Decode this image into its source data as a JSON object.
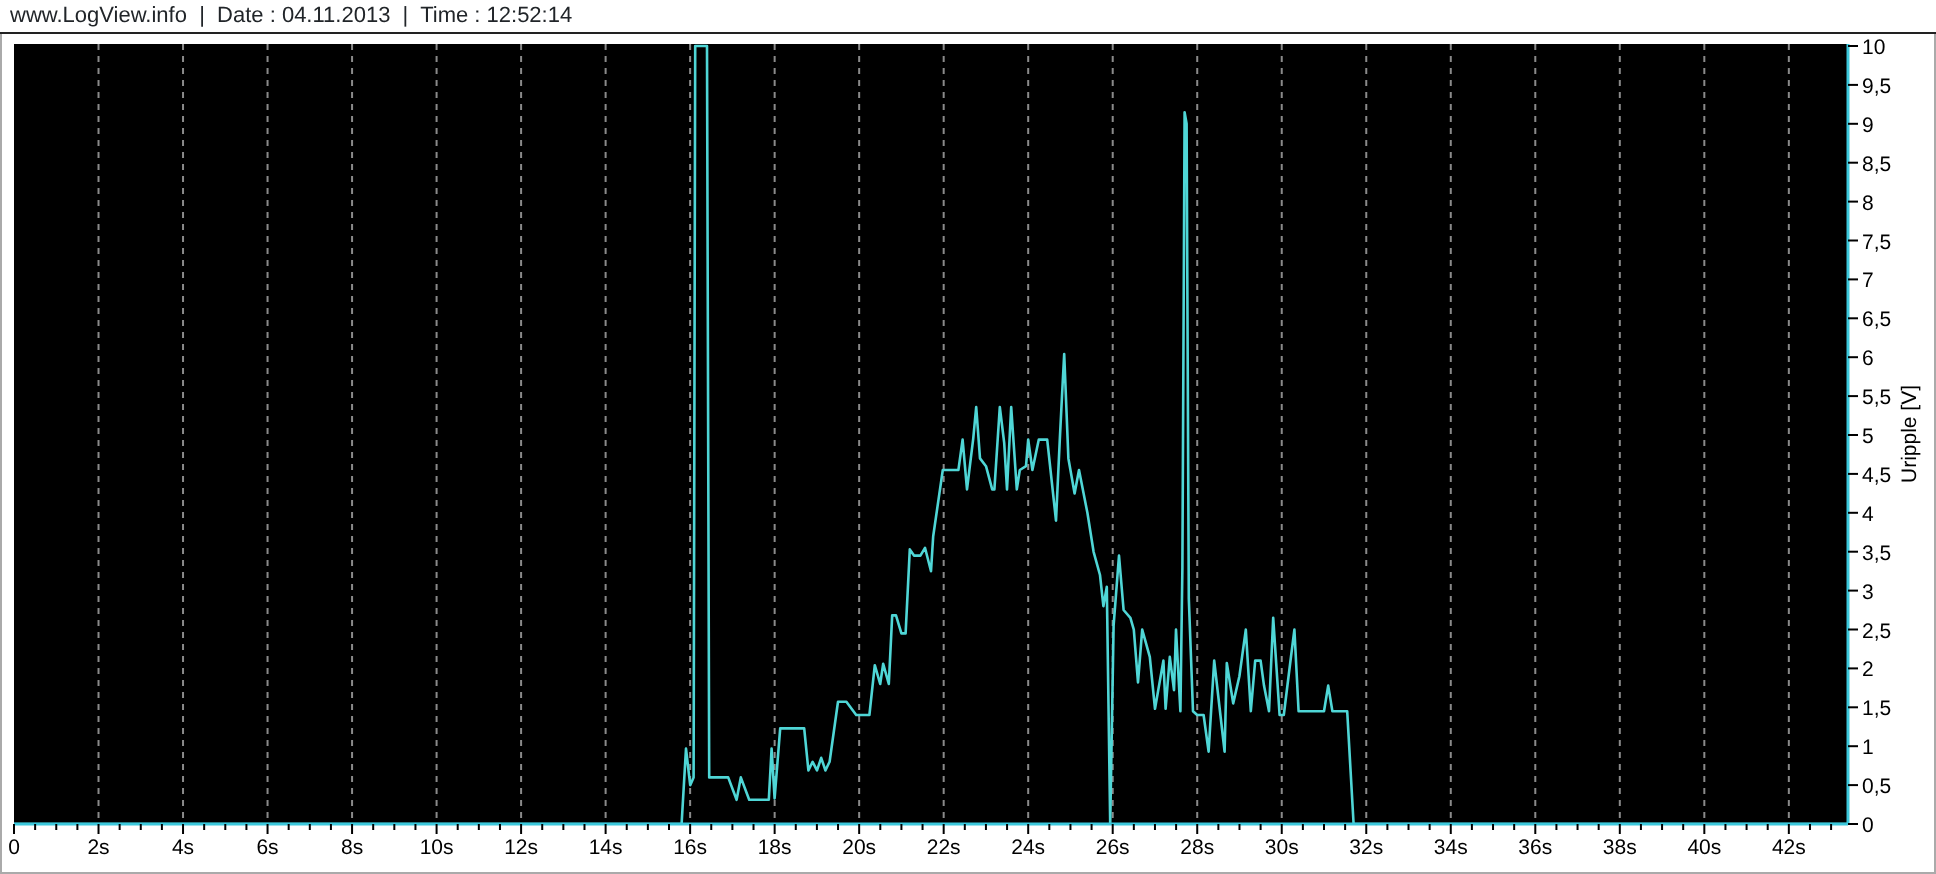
{
  "header": {
    "text": "www.LogView.info  |  Date : 04.11.2013  |  Time : 12:52:14"
  },
  "chart": {
    "chart_data": {
      "type": "line",
      "ylabel": "Uripple [V]",
      "xlim": [
        0,
        43.4
      ],
      "ylim": [
        0,
        10
      ],
      "xticks": [
        {
          "value": 0,
          "label": "0"
        },
        {
          "value": 2,
          "label": "2s"
        },
        {
          "value": 4,
          "label": "4s"
        },
        {
          "value": 6,
          "label": "6s"
        },
        {
          "value": 8,
          "label": "8s"
        },
        {
          "value": 10,
          "label": "10s"
        },
        {
          "value": 12,
          "label": "12s"
        },
        {
          "value": 14,
          "label": "14s"
        },
        {
          "value": 16,
          "label": "16s"
        },
        {
          "value": 18,
          "label": "18s"
        },
        {
          "value": 20,
          "label": "20s"
        },
        {
          "value": 22,
          "label": "22s"
        },
        {
          "value": 24,
          "label": "24s"
        },
        {
          "value": 26,
          "label": "26s"
        },
        {
          "value": 28,
          "label": "28s"
        },
        {
          "value": 30,
          "label": "30s"
        },
        {
          "value": 32,
          "label": "32s"
        },
        {
          "value": 34,
          "label": "34s"
        },
        {
          "value": 36,
          "label": "36s"
        },
        {
          "value": 38,
          "label": "38s"
        },
        {
          "value": 40,
          "label": "40s"
        },
        {
          "value": 42,
          "label": "42s"
        }
      ],
      "yticks": [
        {
          "value": 0,
          "label": "0"
        },
        {
          "value": 0.5,
          "label": "0,5"
        },
        {
          "value": 1,
          "label": "1"
        },
        {
          "value": 1.5,
          "label": "1,5"
        },
        {
          "value": 2,
          "label": "2"
        },
        {
          "value": 2.5,
          "label": "2,5"
        },
        {
          "value": 3,
          "label": "3"
        },
        {
          "value": 3.5,
          "label": "3,5"
        },
        {
          "value": 4,
          "label": "4"
        },
        {
          "value": 4.5,
          "label": "4,5"
        },
        {
          "value": 5,
          "label": "5"
        },
        {
          "value": 5.5,
          "label": "5,5"
        },
        {
          "value": 6,
          "label": "6"
        },
        {
          "value": 6.5,
          "label": "6,5"
        },
        {
          "value": 7,
          "label": "7"
        },
        {
          "value": 7.5,
          "label": "7,5"
        },
        {
          "value": 8,
          "label": "8"
        },
        {
          "value": 8.5,
          "label": "8,5"
        },
        {
          "value": 9,
          "label": "9"
        },
        {
          "value": 9.5,
          "label": "9,5"
        },
        {
          "value": 10,
          "label": "10"
        }
      ],
      "x": [
        0,
        15.8,
        15.9,
        16.0,
        16.08,
        16.12,
        16.4,
        16.45,
        16.9,
        17.1,
        17.2,
        17.4,
        17.86,
        17.93,
        18.0,
        18.13,
        18.7,
        18.8,
        18.9,
        19.0,
        19.1,
        19.2,
        19.3,
        19.5,
        19.7,
        19.93,
        20.24,
        20.37,
        20.5,
        20.57,
        20.7,
        20.78,
        20.87,
        21.0,
        21.1,
        21.2,
        21.3,
        21.45,
        21.56,
        21.7,
        21.75,
        21.98,
        22.35,
        22.45,
        22.55,
        22.7,
        22.77,
        22.86,
        23.0,
        23.15,
        23.2,
        23.33,
        23.43,
        23.5,
        23.6,
        23.73,
        23.8,
        23.95,
        24.0,
        24.1,
        24.25,
        24.45,
        24.66,
        24.75,
        24.8,
        24.85,
        24.95,
        25.1,
        25.2,
        25.4,
        25.55,
        25.7,
        25.78,
        25.86,
        25.94,
        26.02,
        26.15,
        26.26,
        26.42,
        26.5,
        26.6,
        26.7,
        26.88,
        27.0,
        27.2,
        27.25,
        27.35,
        27.45,
        27.5,
        27.6,
        27.65,
        27.7,
        27.75,
        27.8,
        27.9,
        28.0,
        28.15,
        28.27,
        28.4,
        28.55,
        28.65,
        28.7,
        28.85,
        29.0,
        29.15,
        29.27,
        29.37,
        29.5,
        29.58,
        29.7,
        29.8,
        29.95,
        30.05,
        30.2,
        30.3,
        30.4,
        31.0,
        31.1,
        31.2,
        31.55,
        31.7,
        43.4
      ],
      "grid": true,
      "series": [
        {
          "color": "#4fd6d6",
          "values": [
            0,
            0,
            0.97,
            0.5,
            0.6,
            10,
            10,
            0.6,
            0.6,
            0.31,
            0.6,
            0.31,
            0.31,
            0.97,
            0.33,
            1.23,
            1.23,
            0.69,
            0.8,
            0.69,
            0.85,
            0.69,
            0.8,
            1.57,
            1.57,
            1.4,
            1.4,
            2.04,
            1.8,
            2.06,
            1.8,
            2.68,
            2.68,
            2.45,
            2.45,
            3.53,
            3.45,
            3.45,
            3.55,
            3.25,
            3.7,
            4.55,
            4.55,
            4.94,
            4.3,
            4.95,
            5.36,
            4.7,
            4.6,
            4.3,
            4.3,
            5.36,
            4.9,
            4.3,
            5.36,
            4.3,
            4.55,
            4.6,
            4.94,
            4.55,
            4.94,
            4.94,
            3.9,
            4.94,
            5.5,
            6.04,
            4.7,
            4.25,
            4.55,
            4.0,
            3.5,
            3.2,
            2.8,
            3.05,
            0,
            2.55,
            3.45,
            2.75,
            2.65,
            2.5,
            1.82,
            2.5,
            2.15,
            1.48,
            2.1,
            1.48,
            2.15,
            1.72,
            2.5,
            1.45,
            3.3,
            9.15,
            9.0,
            2.9,
            1.45,
            1.4,
            1.4,
            0.93,
            2.1,
            1.4,
            0.93,
            2.07,
            1.55,
            1.9,
            2.5,
            1.45,
            2.1,
            2.1,
            1.78,
            1.45,
            2.65,
            1.4,
            1.4,
            2.07,
            2.5,
            1.45,
            1.45,
            1.78,
            1.45,
            1.45,
            0,
            0
          ]
        }
      ]
    }
  }
}
